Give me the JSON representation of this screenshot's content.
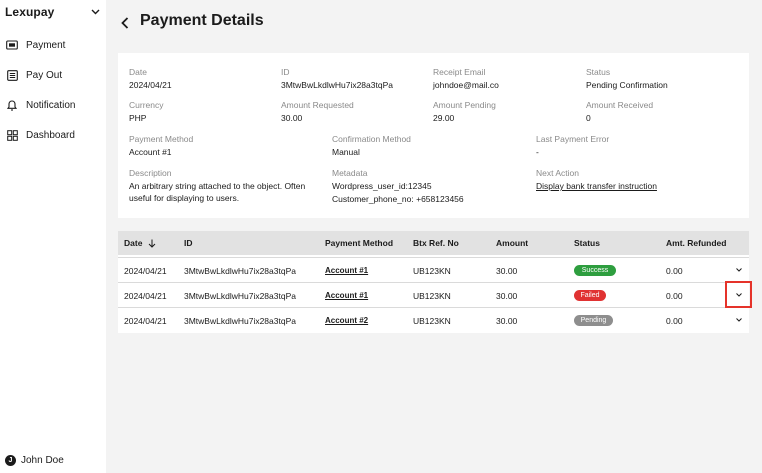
{
  "sidebar": {
    "brand": "Lexupay",
    "items": [
      {
        "label": "Payment",
        "icon": "payment-icon"
      },
      {
        "label": "Pay Out",
        "icon": "payout-icon"
      },
      {
        "label": "Notification",
        "icon": "bell-icon"
      },
      {
        "label": "Dashboard",
        "icon": "dashboard-icon"
      }
    ],
    "user": {
      "initial": "J",
      "name": "John Doe"
    }
  },
  "header": {
    "title": "Payment Details"
  },
  "details": {
    "date": {
      "label": "Date",
      "value": "2024/04/21"
    },
    "id": {
      "label": "ID",
      "value": "3MtwBwLkdlwHu7ix28a3tqPa"
    },
    "receipt_email": {
      "label": "Receipt Email",
      "value": "johndoe@mail.co"
    },
    "status": {
      "label": "Status",
      "value": "Pending Confirmation"
    },
    "currency": {
      "label": "Currency",
      "value": "PHP"
    },
    "amount_requested": {
      "label": "Amount Requested",
      "value": "30.00"
    },
    "amount_pending": {
      "label": "Amount Pending",
      "value": "29.00"
    },
    "amount_received": {
      "label": "Amount Received",
      "value": "0"
    },
    "payment_method": {
      "label": "Payment Method",
      "value": "Account #1"
    },
    "confirmation_method": {
      "label": "Confirmation Method",
      "value": "Manual"
    },
    "last_payment_error": {
      "label": "Last Payment Error",
      "value": "-"
    },
    "description": {
      "label": "Description",
      "value": "An arbitrary string attached to the object. Often useful for displaying to users."
    },
    "metadata": {
      "label": "Metadata",
      "line1": "Wordpress_user_id:12345",
      "line2": "Customer_phone_no: +658123456"
    },
    "next_action": {
      "label": "Next Action",
      "value": "Display bank transfer instruction"
    }
  },
  "table": {
    "columns": [
      "Date",
      "ID",
      "Payment Method",
      "Btx Ref. No",
      "Amount",
      "Status",
      "Amt. Refunded"
    ],
    "rows": [
      {
        "date": "2024/04/21",
        "id": "3MtwBwLkdlwHu7ix28a3tqPa",
        "method": "Account #1",
        "ref": "UB123KN",
        "amount": "30.00",
        "status": "Success",
        "refunded": "0.00"
      },
      {
        "date": "2024/04/21",
        "id": "3MtwBwLkdlwHu7ix28a3tqPa",
        "method": "Account #1",
        "ref": "UB123KN",
        "amount": "30.00",
        "status": "Failed",
        "refunded": "0.00"
      },
      {
        "date": "2024/04/21",
        "id": "3MtwBwLkdlwHu7ix28a3tqPa",
        "method": "Account #2",
        "ref": "UB123KN",
        "amount": "30.00",
        "status": "Pending",
        "refunded": "0.00"
      }
    ]
  },
  "colors": {
    "success": "#2e9e3f",
    "failed": "#e03232",
    "pending": "#8e8e8e",
    "highlight": "#e5332a"
  }
}
